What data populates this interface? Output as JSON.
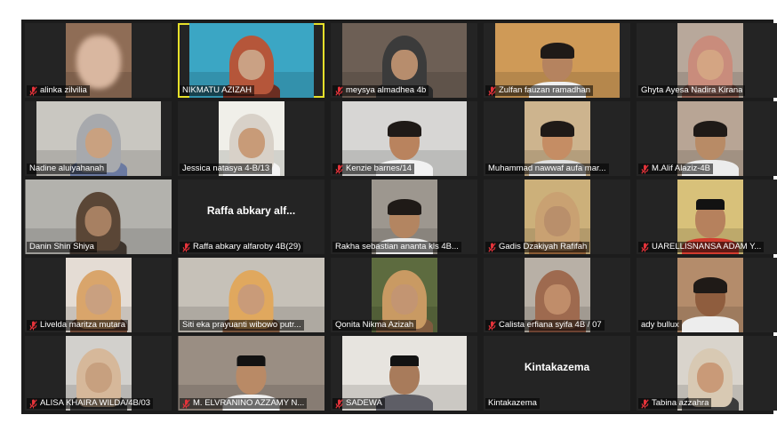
{
  "participants": [
    {
      "name": "alinka zilvilia",
      "muted": true
    },
    {
      "name": "NIKMATU AZIZAH",
      "muted": false,
      "active": true
    },
    {
      "name": "meysya almadhea 4b",
      "muted": true
    },
    {
      "name": "Zulfan fauzan ramadhan",
      "muted": true
    },
    {
      "name": "Ghyta Ayesa Nadira Kirana",
      "muted": false
    },
    {
      "name": "Nadine aluiyahanah",
      "muted": false
    },
    {
      "name": "Jessica natasya 4-B/13",
      "muted": false
    },
    {
      "name": "Kenzie barnes/14",
      "muted": true
    },
    {
      "name": "Muhammad nawwaf aufa mar...",
      "muted": false
    },
    {
      "name": "M.Alif Alaziz-4B",
      "muted": true
    },
    {
      "name": "Danin Shin Shiya",
      "muted": false
    },
    {
      "name": "Raffa abkary alfaroby 4B(29)",
      "muted": true,
      "display_name": "Raffa abkary alf..."
    },
    {
      "name": "Rakha sebastian ananta kls 4B...",
      "muted": false
    },
    {
      "name": "Gadis Dzakiyah Rafifah",
      "muted": true
    },
    {
      "name": "UARELLISNANSA ADAM Y...",
      "muted": true
    },
    {
      "name": "Livelda maritza mutara",
      "muted": true
    },
    {
      "name": "Siti eka prayuanti wibowo putr...",
      "muted": false
    },
    {
      "name": "Qonita Nikma Azizah",
      "muted": false
    },
    {
      "name": "Calista erfiana syifa 4B / 07",
      "muted": true
    },
    {
      "name": "ady bullux",
      "muted": false
    },
    {
      "name": "ALISA KHAIRA WILDA/4B/03",
      "muted": true
    },
    {
      "name": "M. ELVRANINO AZZAMY N...",
      "muted": true
    },
    {
      "name": "SADEWA",
      "muted": true
    },
    {
      "name": "Kintakazema",
      "muted": false,
      "display_name": "Kintakazema"
    },
    {
      "name": "Tabina azzahra",
      "muted": true
    }
  ],
  "colors": {
    "active_speaker_border": "#e6e02a",
    "muted_mic": "#e5333a",
    "label_text": "#ffffff"
  },
  "icons": {
    "muted": "muted-microphone-icon"
  }
}
